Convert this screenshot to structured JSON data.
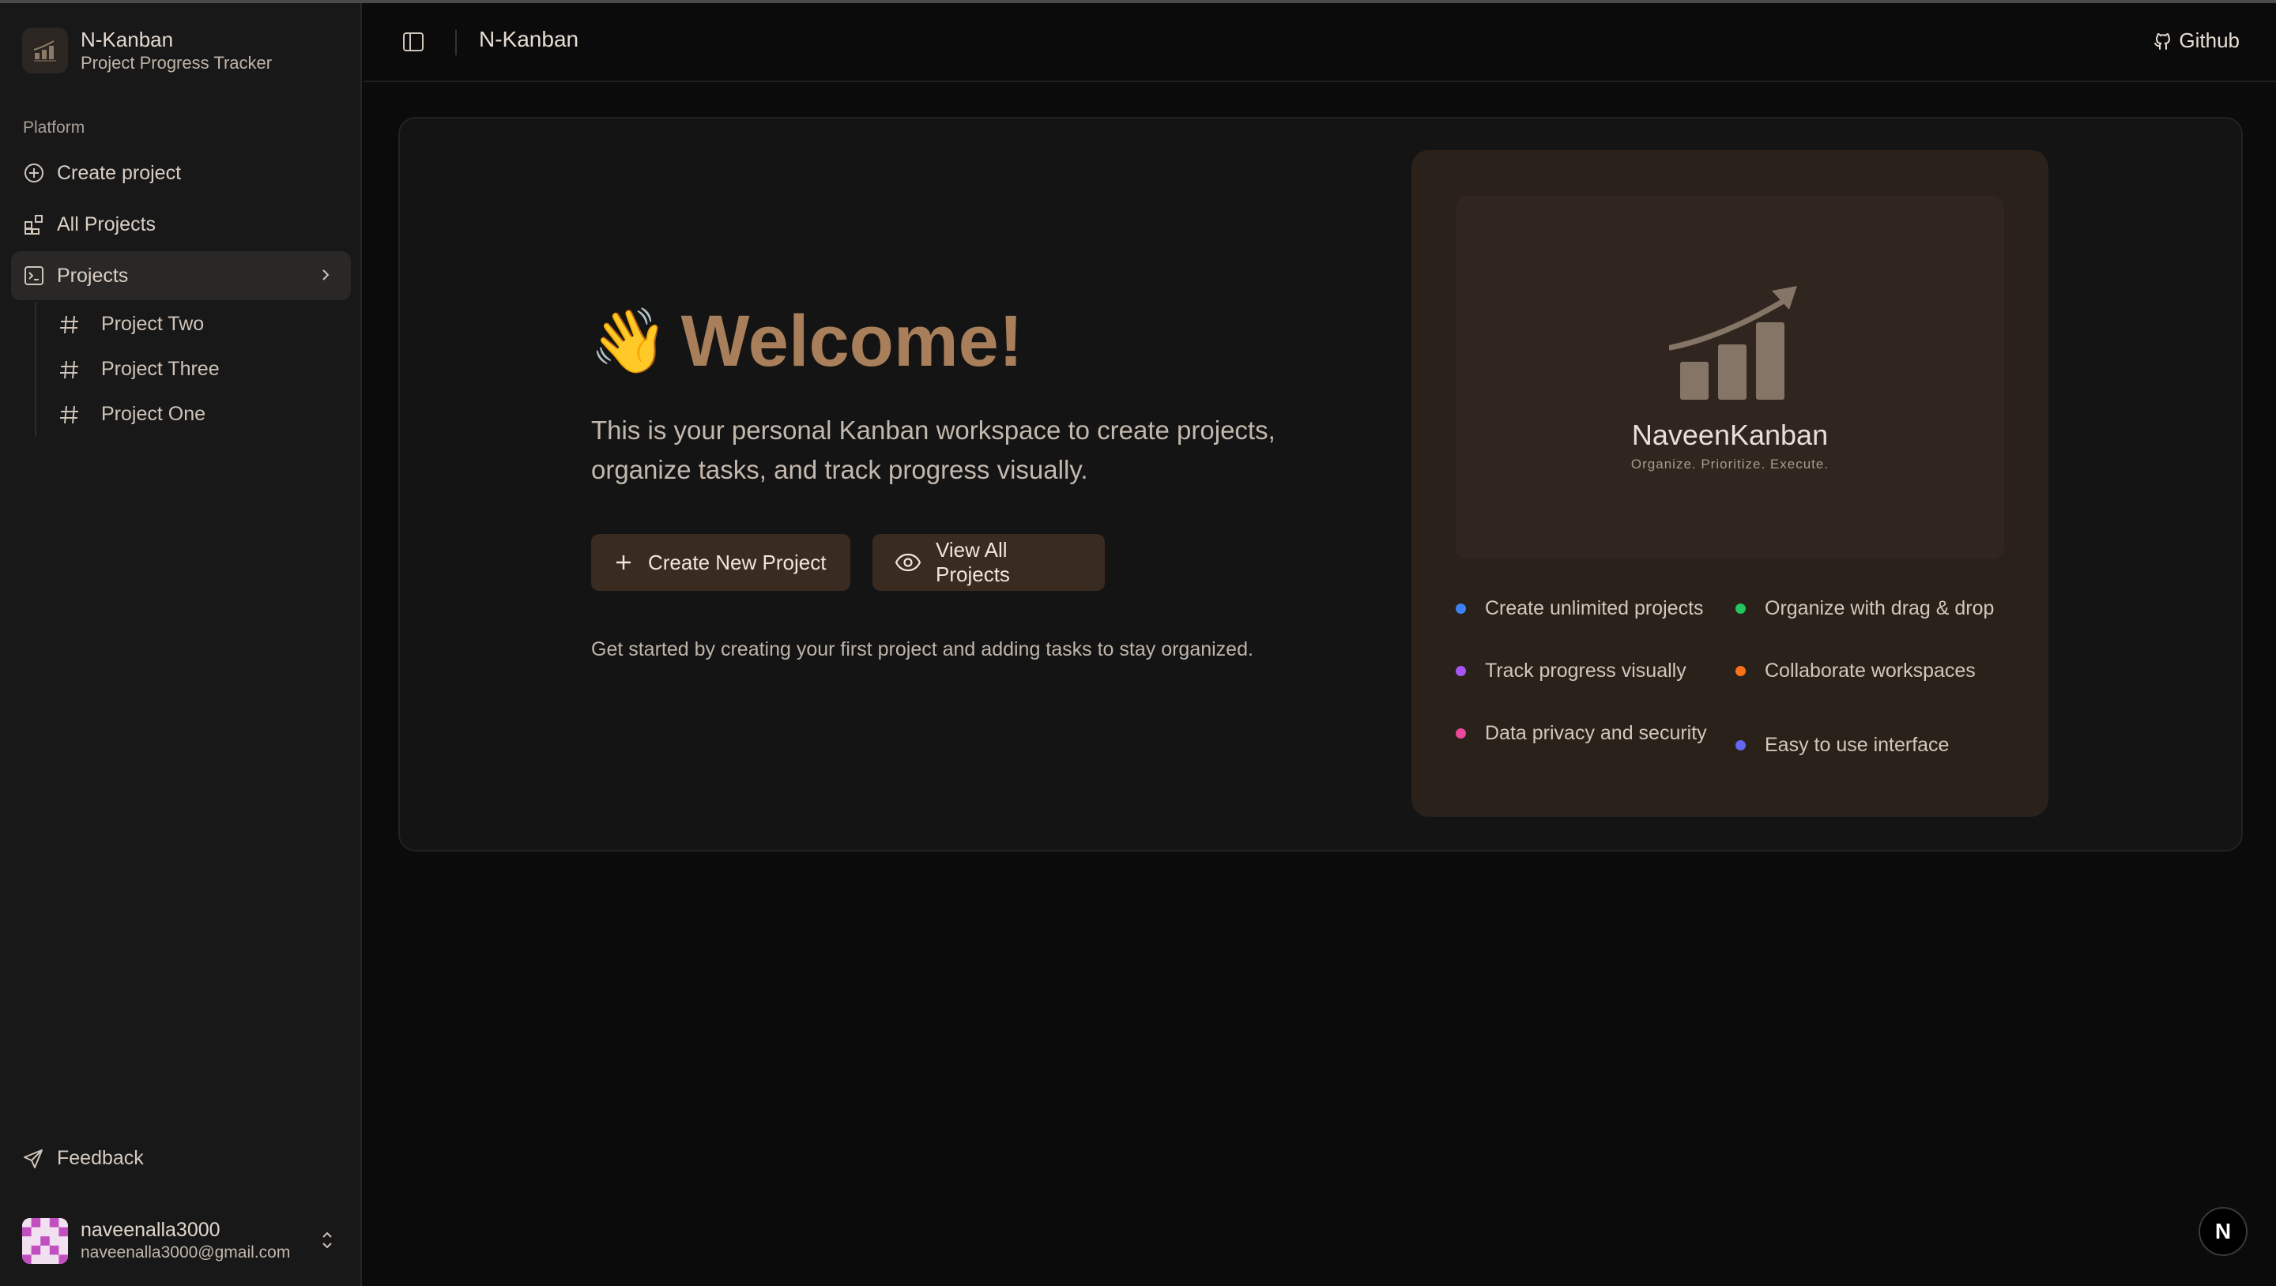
{
  "brand": {
    "title": "N-Kanban",
    "subtitle": "Project Progress Tracker"
  },
  "sidebar": {
    "group_label": "Platform",
    "items": [
      {
        "label": "Create project",
        "icon": "plus-circle-icon"
      },
      {
        "label": "All Projects",
        "icon": "grid-icon"
      },
      {
        "label": "Projects",
        "icon": "terminal-square-icon"
      }
    ],
    "projects": [
      {
        "label": "Project Two",
        "icon": "hash-icon"
      },
      {
        "label": "Project Three",
        "icon": "hash-icon"
      },
      {
        "label": "Project One",
        "icon": "hash-icon"
      }
    ],
    "feedback_label": "Feedback",
    "user": {
      "name": "naveenalla3000",
      "email": "naveenalla3000@gmail.com"
    }
  },
  "header": {
    "title": "N-Kanban",
    "github_label": "Github"
  },
  "main": {
    "wave": "👋",
    "welcome": "Welcome!",
    "description": "This is your personal Kanban workspace to create projects, organize tasks, and track progress visually.",
    "create_button": "Create New Project",
    "view_button": "View All Projects",
    "hint": "Get started by creating your first project and adding tasks to stay organized.",
    "logo_name": "NaveenKanban",
    "logo_tagline": "Organize. Prioritize. Execute.",
    "features": [
      {
        "label": "Create unlimited projects",
        "color": "#3b82f6"
      },
      {
        "label": "Organize with drag & drop",
        "color": "#22c55e"
      },
      {
        "label": "Track progress visually",
        "color": "#a855f7"
      },
      {
        "label": "Collaborate workspaces",
        "color": "#f97316"
      },
      {
        "label": "Data privacy and security",
        "color": "#ec4899"
      },
      {
        "label": "Easy to use interface",
        "color": "#6366f1"
      }
    ]
  },
  "badge": {
    "letter": "N"
  },
  "colors": {
    "accent": "#a87f5a",
    "button_bg": "#3a2b21",
    "panel_bg": "#2a211b"
  }
}
